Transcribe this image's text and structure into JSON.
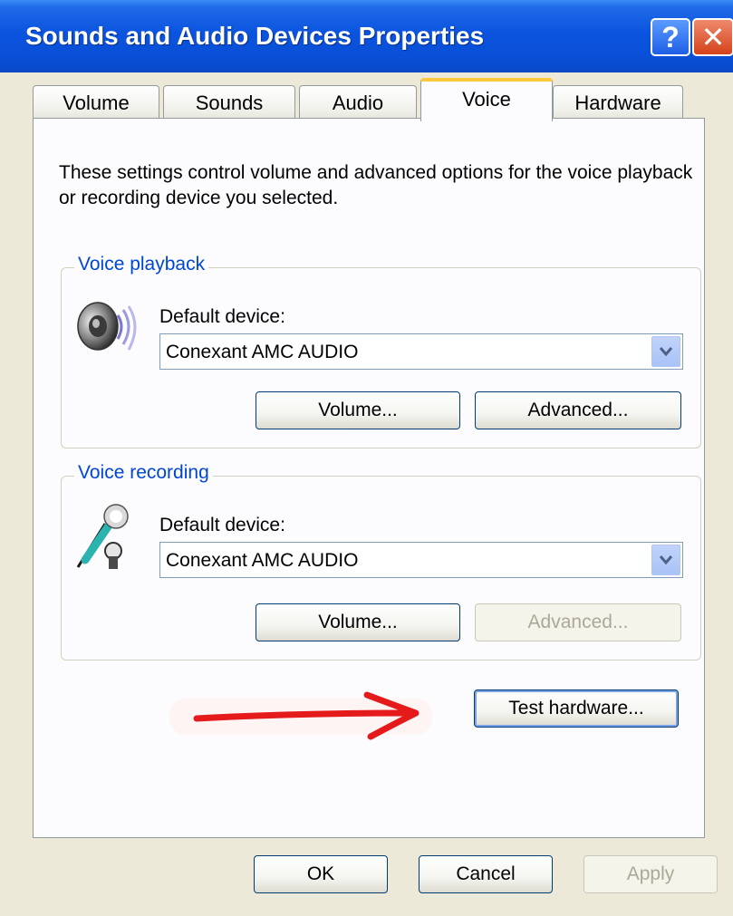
{
  "window": {
    "title": "Sounds and Audio Devices Properties",
    "help_glyph": "?",
    "close_glyph": "✕"
  },
  "tabs": [
    {
      "label": "Volume"
    },
    {
      "label": "Sounds"
    },
    {
      "label": "Audio"
    },
    {
      "label": "Voice",
      "active": true
    },
    {
      "label": "Hardware"
    }
  ],
  "description": "These settings control volume and advanced options for the voice playback or recording device you selected.",
  "voice_playback": {
    "title": "Voice playback",
    "icon": "speaker-icon",
    "default_label": "Default device:",
    "device": "Conexant AMC AUDIO",
    "volume_label": "Volume...",
    "advanced_label": "Advanced..."
  },
  "voice_recording": {
    "title": "Voice recording",
    "icon": "microphone-icon",
    "default_label": "Default device:",
    "device": "Conexant AMC AUDIO",
    "volume_label": "Volume...",
    "advanced_label": "Advanced...",
    "advanced_disabled": true
  },
  "test_hardware_label": "Test hardware...",
  "footer": {
    "ok_label": "OK",
    "cancel_label": "Cancel",
    "apply_label": "Apply",
    "apply_disabled": true
  },
  "colors": {
    "titlebar": "#0A54DF",
    "group_title": "#0046D5",
    "active_tab_accent": "#FFC83C",
    "annotation_arrow": "#E51A1A"
  }
}
